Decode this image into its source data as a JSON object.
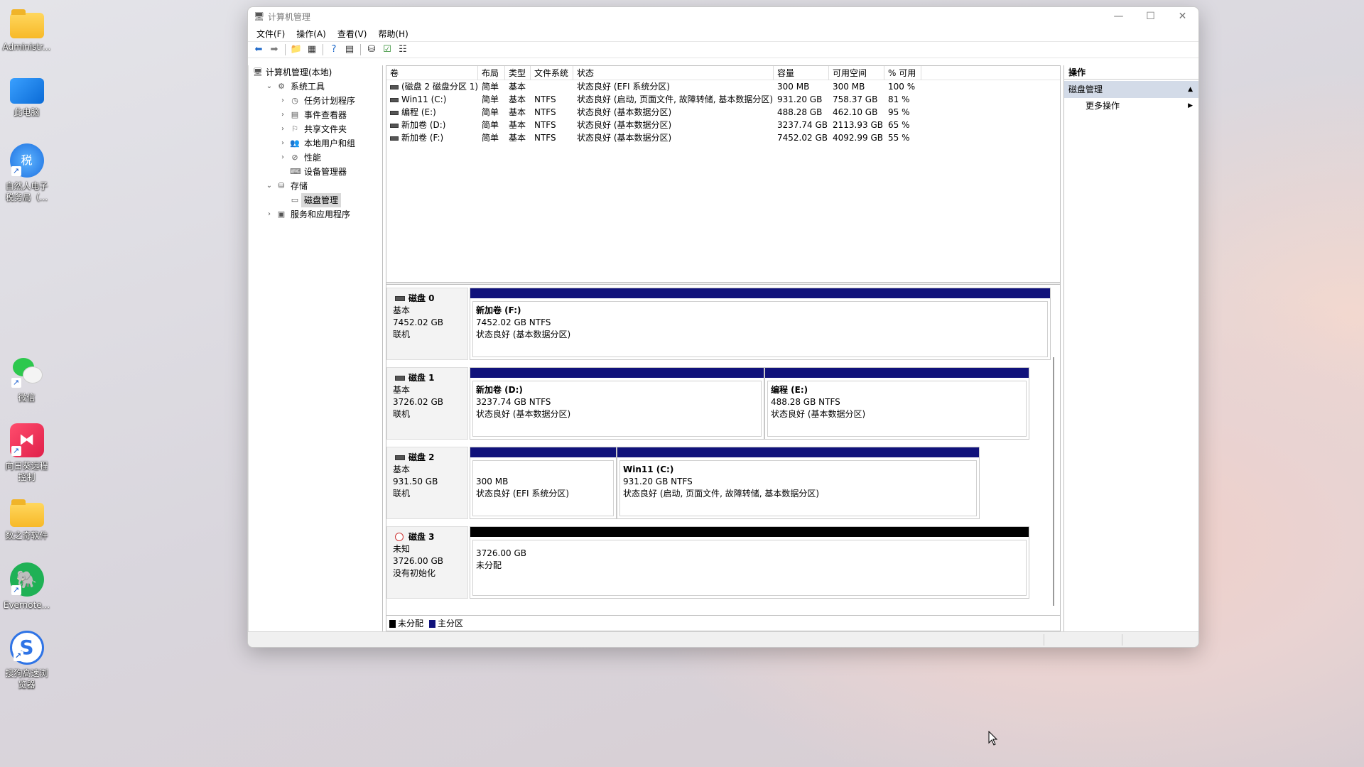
{
  "desktop": {
    "icons": [
      {
        "label": "Administr...",
        "kind": "folder"
      },
      {
        "label": "此电脑",
        "kind": "monitor"
      },
      {
        "label": "自然人电子税务局（...",
        "kind": "tax"
      },
      {
        "label": "微信",
        "kind": "wechat"
      },
      {
        "label": "向日葵远程控制",
        "kind": "sunlogin"
      },
      {
        "label": "数之奇软件",
        "kind": "folder"
      },
      {
        "label": "Evernote...",
        "kind": "evernote"
      },
      {
        "label": "搜狗高速浏览器",
        "kind": "sogou"
      }
    ]
  },
  "window": {
    "title": "计算机管理",
    "controls": {
      "minimize": "—",
      "maximize": "☐",
      "close": "✕"
    },
    "menu": [
      "文件(F)",
      "操作(A)",
      "查看(V)",
      "帮助(H)"
    ]
  },
  "tree": [
    {
      "label": "计算机管理(本地)",
      "level": 0,
      "arrow": "",
      "icon": "computer-management-icon"
    },
    {
      "label": "系统工具",
      "level": 1,
      "arrow": "v",
      "icon": "tools-icon"
    },
    {
      "label": "任务计划程序",
      "level": 2,
      "arrow": ">",
      "icon": "clock-icon"
    },
    {
      "label": "事件查看器",
      "level": 2,
      "arrow": ">",
      "icon": "event-viewer-icon"
    },
    {
      "label": "共享文件夹",
      "level": 2,
      "arrow": ">",
      "icon": "shared-folder-icon"
    },
    {
      "label": "本地用户和组",
      "level": 2,
      "arrow": ">",
      "icon": "users-icon"
    },
    {
      "label": "性能",
      "level": 2,
      "arrow": ">",
      "icon": "performance-icon"
    },
    {
      "label": "设备管理器",
      "level": 2,
      "arrow": "",
      "icon": "device-manager-icon"
    },
    {
      "label": "存储",
      "level": 1,
      "arrow": "v",
      "icon": "storage-icon"
    },
    {
      "label": "磁盘管理",
      "level": 2,
      "arrow": "",
      "icon": "disk-management-icon",
      "selected": true
    },
    {
      "label": "服务和应用程序",
      "level": 1,
      "arrow": ">",
      "icon": "services-icon"
    }
  ],
  "volumes": {
    "headers": [
      "卷",
      "布局",
      "类型",
      "文件系统",
      "状态",
      "容量",
      "可用空间",
      "% 可用"
    ],
    "rows": [
      [
        "(磁盘 2 磁盘分区 1)",
        "简单",
        "基本",
        "",
        "状态良好 (EFI 系统分区)",
        "300 MB",
        "300 MB",
        "100 %"
      ],
      [
        "Win11 (C:)",
        "简单",
        "基本",
        "NTFS",
        "状态良好 (启动, 页面文件, 故障转储, 基本数据分区)",
        "931.20 GB",
        "758.37 GB",
        "81 %"
      ],
      [
        "编程 (E:)",
        "简单",
        "基本",
        "NTFS",
        "状态良好 (基本数据分区)",
        "488.28 GB",
        "462.10 GB",
        "95 %"
      ],
      [
        "新加卷 (D:)",
        "简单",
        "基本",
        "NTFS",
        "状态良好 (基本数据分区)",
        "3237.74 GB",
        "2113.93 GB",
        "65 %"
      ],
      [
        "新加卷 (F:)",
        "简单",
        "基本",
        "NTFS",
        "状态良好 (基本数据分区)",
        "7452.02 GB",
        "4092.99 GB",
        "55 %"
      ]
    ]
  },
  "disks": [
    {
      "name": "磁盘 0",
      "type": "基本",
      "size": "7452.02 GB",
      "state": "联机",
      "partitions": [
        {
          "title": "新加卷 (F:)",
          "size": "7452.02 GB NTFS",
          "status": "状态良好 (基本数据分区)"
        }
      ]
    },
    {
      "name": "磁盘 1",
      "type": "基本",
      "size": "3726.02 GB",
      "state": "联机",
      "partitions": [
        {
          "title": "新加卷 (D:)",
          "size": "3237.74 GB NTFS",
          "status": "状态良好 (基本数据分区)"
        },
        {
          "title": "编程 (E:)",
          "size": "488.28 GB NTFS",
          "status": "状态良好 (基本数据分区)"
        }
      ]
    },
    {
      "name": "磁盘 2",
      "type": "基本",
      "size": "931.50 GB",
      "state": "联机",
      "partitions": [
        {
          "title": "",
          "size": "300 MB",
          "status": "状态良好 (EFI 系统分区)"
        },
        {
          "title": "Win11 (C:)",
          "size": "931.20 GB NTFS",
          "status": "状态良好 (启动, 页面文件, 故障转储, 基本数据分区)"
        }
      ]
    },
    {
      "name": "磁盘 3",
      "type": "未知",
      "size": "3726.00 GB",
      "state": "没有初始化",
      "partitions": [
        {
          "title": "",
          "size": "3726.00 GB",
          "status": "未分配"
        }
      ]
    }
  ],
  "legend": {
    "unallocated": "未分配",
    "primary": "主分区",
    "unallocated_color": "#000000",
    "primary_color": "#10127b"
  },
  "actions": {
    "header": "操作",
    "section": "磁盘管理",
    "more": "更多操作"
  }
}
